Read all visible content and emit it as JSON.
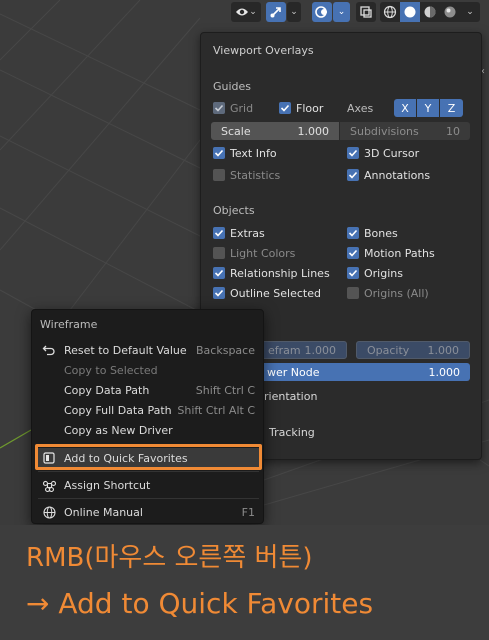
{
  "colors": {
    "accent": "#4772b3",
    "highlight": "#f08a35",
    "panel_bg": "#2b2b2b",
    "menu_bg": "#1c1c1c",
    "viewport_bg": "#3b3b3b",
    "axis_green": "#6f9a2e"
  },
  "toolbar": {
    "icons": [
      "eye-icon",
      "gizmo-icon",
      "overlay-icon",
      "xray-icon",
      "wireframe-shading-icon",
      "solid-shading-icon",
      "material-shading-icon",
      "rendered-shading-icon"
    ],
    "active_shading": "solid"
  },
  "overlays": {
    "title": "Viewport Overlays",
    "guides": {
      "heading": "Guides",
      "grid": "Grid",
      "floor": "Floor",
      "axes": "Axes",
      "x": "X",
      "y": "Y",
      "z": "Z",
      "scale_label": "Scale",
      "scale_value": "1.000",
      "subdivisions_label": "Subdivisions",
      "subdivisions_value": "10",
      "text_info": "Text Info",
      "cursor_3d": "3D Cursor",
      "statistics": "Statistics",
      "annotations": "Annotations"
    },
    "objects": {
      "heading": "Objects",
      "extras": "Extras",
      "bones": "Bones",
      "light_colors": "Light Colors",
      "motion_paths": "Motion Paths",
      "relationship_lines": "Relationship Lines",
      "origins": "Origins",
      "outline_selected": "Outline Selected",
      "origins_all": "Origins (All)"
    },
    "partial": {
      "wireframe_field_label": "efram",
      "wireframe_field_value": "1.000",
      "opacity_label": "Opacity",
      "opacity_value": "1.000",
      "viewer_node_label": "wer Node",
      "viewer_node_value": "1.000",
      "orientation": "rientation",
      "tracking": "Tracking"
    }
  },
  "context_menu": {
    "title": "Wireframe",
    "items": [
      {
        "label": "Reset to Default Value",
        "shortcut": "Backspace"
      },
      {
        "label": "Copy to Selected",
        "shortcut": ""
      },
      {
        "label": "Copy Data Path",
        "shortcut": "Shift Ctrl C"
      },
      {
        "label": "Copy Full Data Path",
        "shortcut": "Shift Ctrl Alt C"
      },
      {
        "label": "Copy as New Driver",
        "shortcut": ""
      },
      {
        "label": "Add to Quick Favorites",
        "shortcut": ""
      },
      {
        "label": "Assign Shortcut",
        "shortcut": ""
      },
      {
        "label": "Online Manual",
        "shortcut": "F1"
      }
    ]
  },
  "caption": {
    "line1": "RMB(마우스 오른쪽 버튼)",
    "line2": "→ Add to Quick Favorites"
  }
}
